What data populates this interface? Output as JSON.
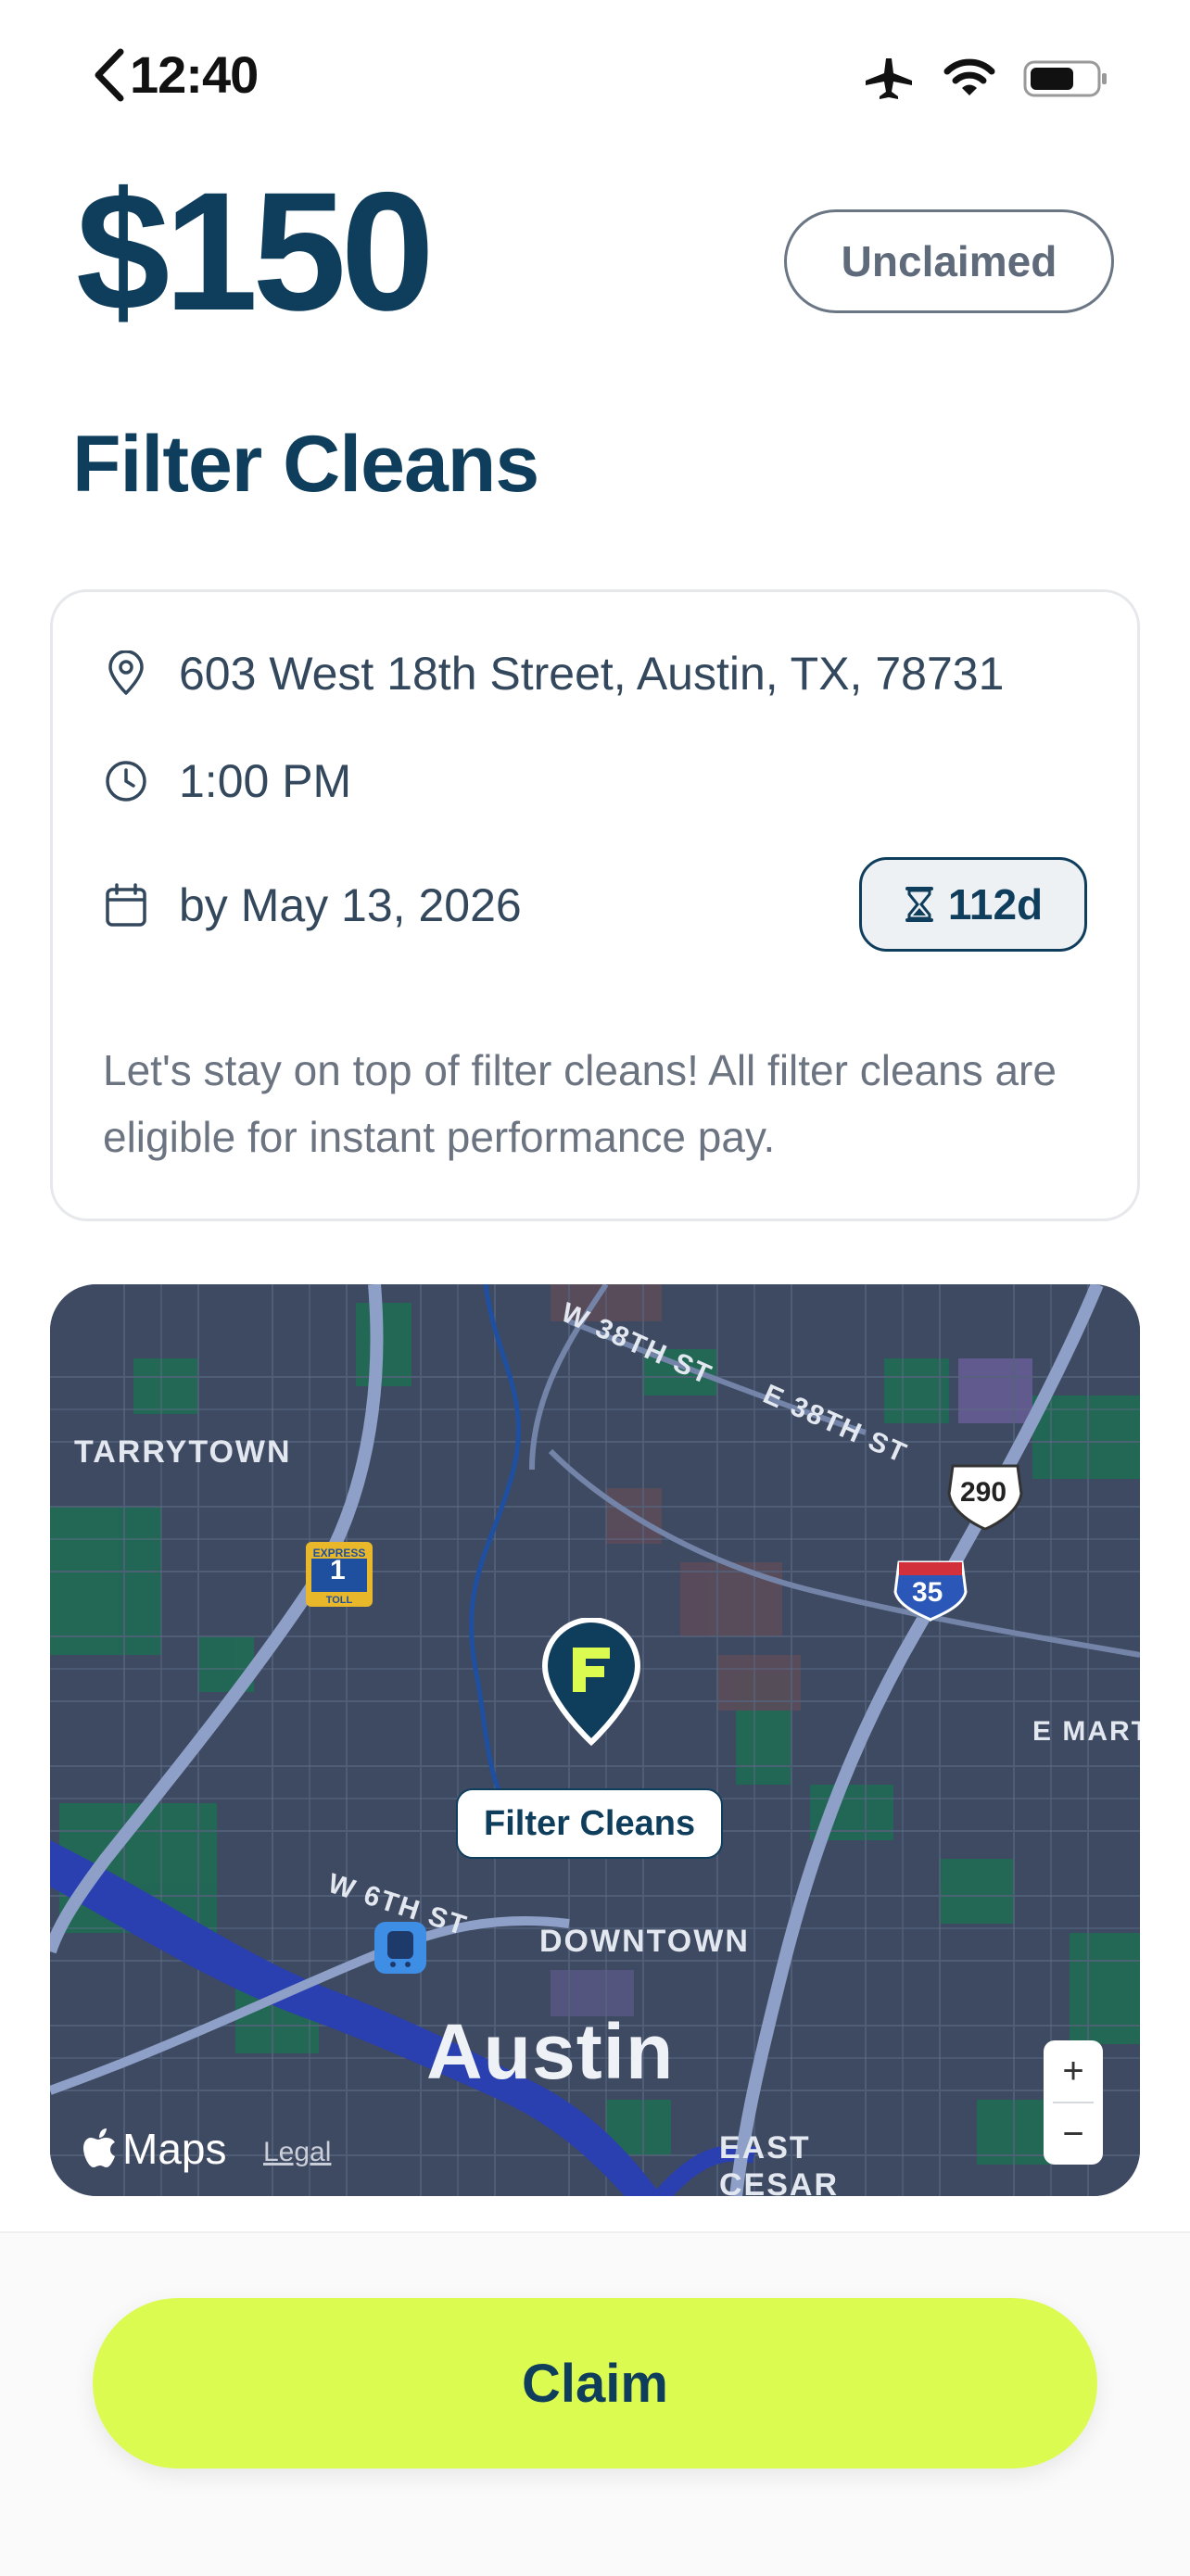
{
  "status_bar": {
    "time": "12:40",
    "icons": [
      "airplane-icon",
      "wifi-icon",
      "battery-icon"
    ]
  },
  "header": {
    "price": "$150",
    "status": "Unclaimed",
    "title": "Filter Cleans"
  },
  "details": {
    "address": "603 West 18th Street, Austin, TX, 78731",
    "time": "1:00 PM",
    "deadline": "by May 13, 2026",
    "days_left": "112d",
    "description": "Let's stay on top of filter cleans! All filter cleans are eligible for instant performance pay."
  },
  "map": {
    "labels": {
      "tarrytown": "TARRYTOWN",
      "downtown": "DOWNTOWN",
      "city": "Austin",
      "east_cesar": "EAST CESAR CHAVEZ",
      "e_mart": "E MART",
      "w6": "W 6TH ST",
      "w38": "W 38TH ST",
      "e38": "E 38TH ST"
    },
    "shields": {
      "toll": "1",
      "us290": "290",
      "i35": "35"
    },
    "pin_label": "Filter Cleans",
    "zoom_in": "+",
    "zoom_out": "−",
    "logo_text": "Maps",
    "legal": "Legal"
  },
  "actions": {
    "claim_label": "Claim"
  },
  "colors": {
    "primary": "#0f3d5c",
    "accent": "#dcfb51",
    "muted_text": "#6b7480",
    "map_base": "#3e4a62"
  }
}
